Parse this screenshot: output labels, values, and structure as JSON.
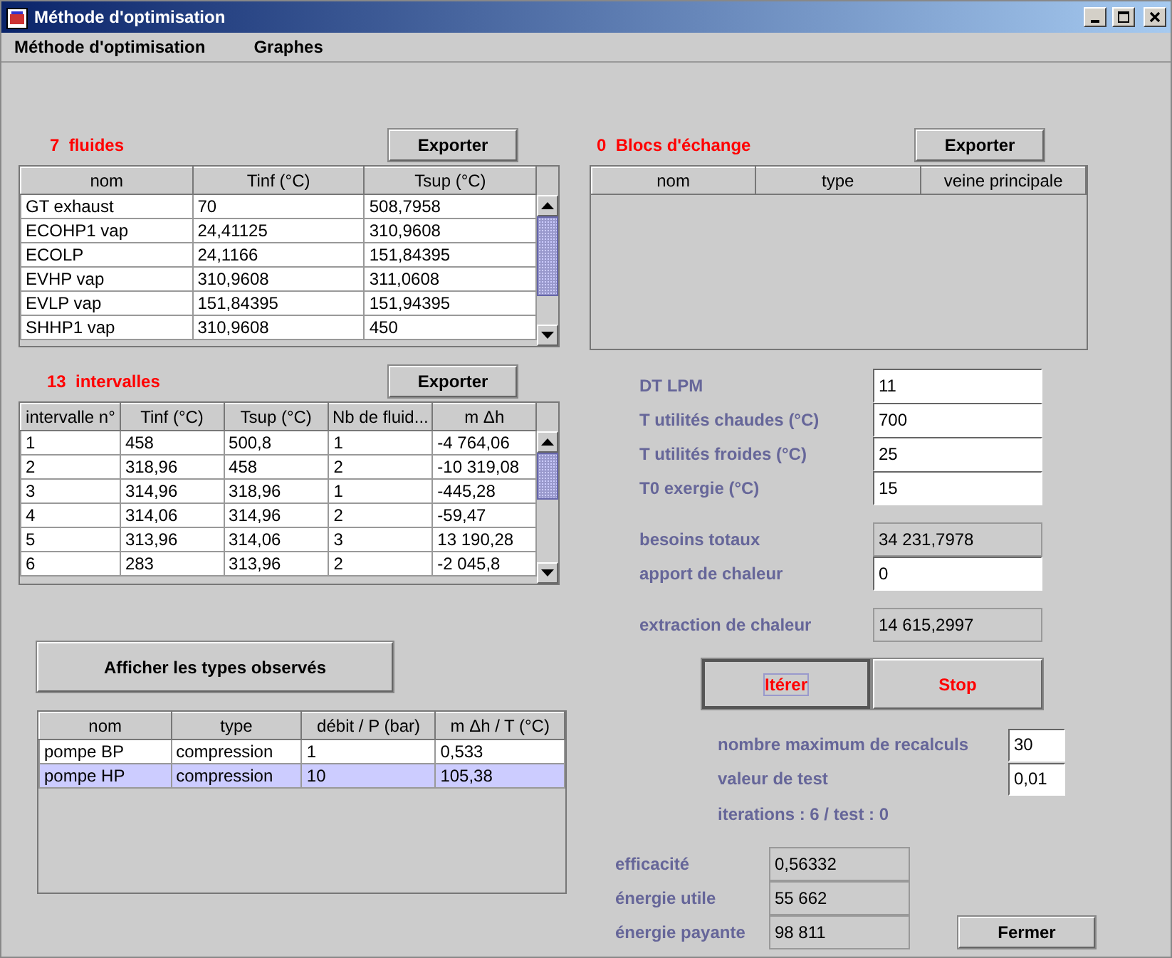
{
  "window": {
    "title": "Méthode d'optimisation"
  },
  "menu": [
    "Méthode d'optimisation",
    "Graphes"
  ],
  "fluids": {
    "heading": "7  fluides",
    "export": "Exporter",
    "columns": [
      "nom",
      "Tinf (°C)",
      "Tsup (°C)"
    ],
    "rows": [
      [
        "GT exhaust",
        "70",
        "508,7958"
      ],
      [
        "ECOHP1 vap",
        "24,41125",
        "310,9608"
      ],
      [
        "ECOLP",
        "24,1166",
        "151,84395"
      ],
      [
        "EVHP vap",
        "310,9608",
        "311,0608"
      ],
      [
        "EVLP vap",
        "151,84395",
        "151,94395"
      ],
      [
        "SHHP1 vap",
        "310,9608",
        "450"
      ]
    ]
  },
  "blocks": {
    "heading": "0  Blocs d'échange",
    "export": "Exporter",
    "columns": [
      "nom",
      "type",
      "veine principale"
    ]
  },
  "intervals": {
    "heading": "13  intervalles",
    "export": "Exporter",
    "columns": [
      "intervalle n°",
      "Tinf (°C)",
      "Tsup (°C)",
      "Nb de fluid...",
      "m Δh"
    ],
    "rows": [
      [
        "1",
        "458",
        "500,8",
        "1",
        "-4 764,06"
      ],
      [
        "2",
        "318,96",
        "458",
        "2",
        "-10 319,08"
      ],
      [
        "3",
        "314,96",
        "318,96",
        "1",
        "-445,28"
      ],
      [
        "4",
        "314,06",
        "314,96",
        "2",
        "-59,47"
      ],
      [
        "5",
        "313,96",
        "314,06",
        "3",
        "13 190,28"
      ],
      [
        "6",
        "283",
        "313,96",
        "2",
        "-2 045,8"
      ]
    ]
  },
  "parameters": [
    {
      "label": "DT LPM",
      "value": "11",
      "kind": "input"
    },
    {
      "label": "T utilités chaudes (°C)",
      "value": "700",
      "kind": "input"
    },
    {
      "label": "T utilités froides (°C)",
      "value": "25",
      "kind": "input"
    },
    {
      "label": "T0 exergie (°C)",
      "value": "15",
      "kind": "input"
    },
    {
      "label": "besoins totaux",
      "value": "34 231,7978",
      "kind": "readonly"
    },
    {
      "label": "apport de chaleur",
      "value": "0",
      "kind": "input"
    },
    {
      "label": "extraction de chaleur",
      "value": "14 615,2997",
      "kind": "readonly"
    }
  ],
  "observed_button": "Afficher les types observés",
  "iterate_button": {
    "label": "Itérer",
    "focused": true
  },
  "stop_button": {
    "label": "Stop"
  },
  "observed_types": {
    "columns": [
      "nom",
      "type",
      "débit / P (bar)",
      "m Δh / T (°C)"
    ],
    "rows": [
      {
        "cells": [
          "pompe BP",
          "compression",
          "1",
          "0,533"
        ],
        "selected": false
      },
      {
        "cells": [
          "pompe HP",
          "compression",
          "10",
          "105,38"
        ],
        "selected": true
      }
    ]
  },
  "iteration_settings": [
    {
      "label": "nombre maximum de recalculs",
      "value": "30"
    },
    {
      "label": "valeur de test",
      "value": "0,01"
    }
  ],
  "iterations_status": "iterations : 6 / test : 0",
  "results": [
    {
      "label": "efficacité",
      "value": "0,56332"
    },
    {
      "label": "énergie utile",
      "value": "55 662"
    },
    {
      "label": "énergie payante",
      "value": "98 811"
    }
  ],
  "close_button": "Fermer"
}
